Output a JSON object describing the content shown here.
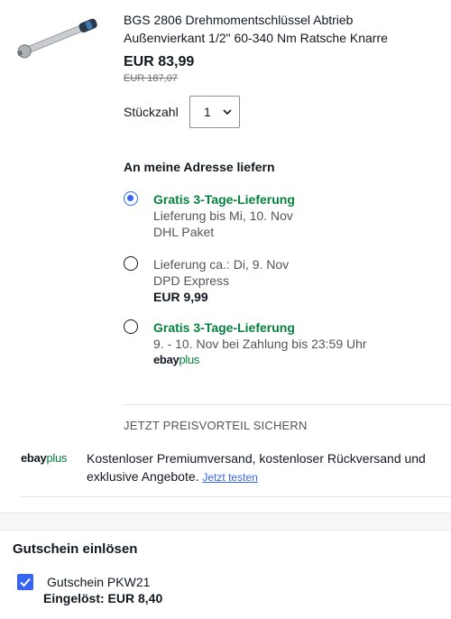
{
  "product": {
    "title": "BGS 2806 Drehmomentschlüssel Abtrieb Außenvierkant 1/2\" 60-340 Nm Ratsche Knarre",
    "price": "EUR 83,99",
    "original_price": "EUR 187,07",
    "image_icon": "torque-wrench-image"
  },
  "quantity": {
    "label": "Stückzahl",
    "value": "1"
  },
  "delivery": {
    "title": "An meine Adresse liefern",
    "options": [
      {
        "selected": true,
        "line1": "Gratis 3-Tage-Lieferung",
        "line2": "Lieferung bis Mi, 10. Nov",
        "line3": "DHL Paket"
      },
      {
        "selected": false,
        "line1": "Lieferung ca.: Di, 9. Nov",
        "line2": "DPD Express",
        "line3": "EUR 9,99"
      },
      {
        "selected": false,
        "line1": "Gratis 3-Tage-Lieferung",
        "line2": "9. - 10. Nov bei Zahlung bis 23:59 Uhr",
        "logo_ebay": "ebay",
        "logo_plus": "plus"
      }
    ]
  },
  "promo": {
    "heading": "JETZT PREISVORTEIL SICHERN",
    "logo_ebay": "ebay",
    "logo_plus": "plus",
    "text": "Kostenloser Premiumversand, kostenloser Rückversand und exklusive Angebote.",
    "link": "Jetzt testen"
  },
  "coupon": {
    "title": "Gutschein einlösen",
    "checked": true,
    "name": "Gutschein PKW21",
    "redeemed": "Eingelöst: EUR 8,40"
  },
  "colors": {
    "accent": "#3665f3",
    "green": "#05823f",
    "text": "#111820"
  }
}
